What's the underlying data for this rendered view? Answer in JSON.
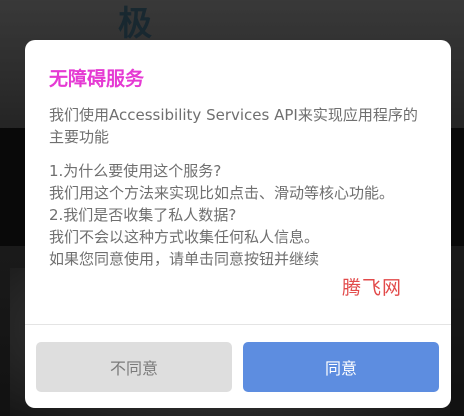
{
  "background": {
    "headline": "极"
  },
  "dialog": {
    "title": "无障碍服务",
    "intro": "我们使用Accessibility Services API来实现应用程序的主要功能",
    "q1": "1.为什么要使用这个服务?",
    "a1": "我们用这个方法来实现比如点击、滑动等核心功能。",
    "q2": "2.我们是否收集了私人数据?",
    "a2": "我们不会以这种方式收集任何私人信息。",
    "consent": "如果您同意使用，请单击同意按钮并继续",
    "cancel_label": "不同意",
    "ok_label": "同意"
  },
  "watermark": "腾飞网",
  "colors": {
    "title": "#e53ad3",
    "primary_button": "#5d8de0",
    "secondary_button": "#dedede",
    "watermark": "#e24a4a"
  }
}
